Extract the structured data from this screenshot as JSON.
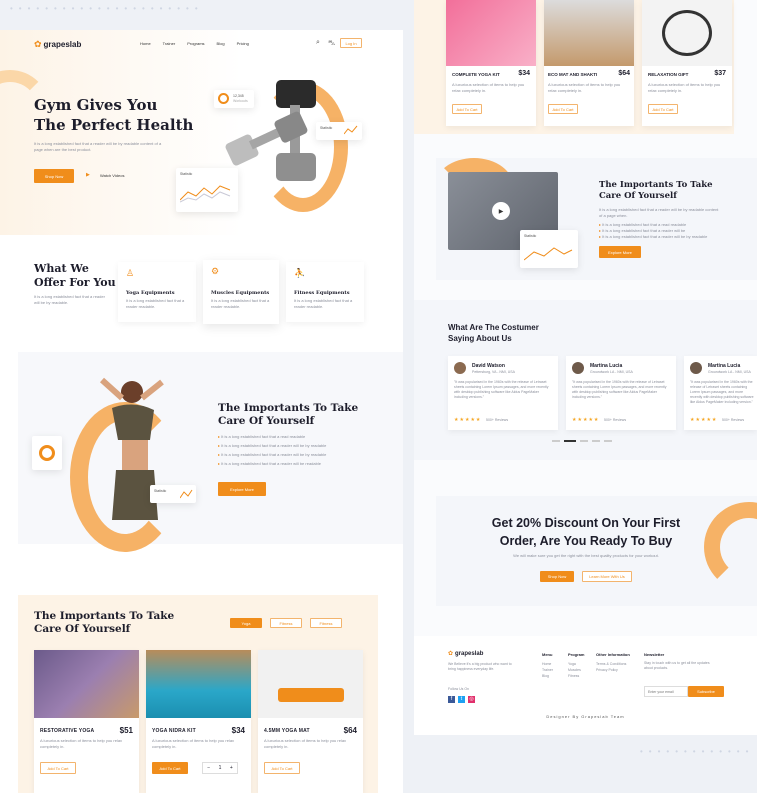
{
  "brand": "grapeslab",
  "nav": {
    "items": [
      "Home",
      "Trainer",
      "Programs",
      "Blog",
      "Pricing"
    ],
    "login": "Log In"
  },
  "hero": {
    "title_line1": "Gym Gives You",
    "title_line2": "The Perfect Health",
    "desc": "It is a long established fact that a reader will be by readable content of a page when are the best product.",
    "cta": "Shop Now",
    "watch": "Watch Videos",
    "stat_chip": "Statistic",
    "stat_value": "12,345",
    "stat_sub": "Workouts"
  },
  "offer": {
    "title_line1": "What We",
    "title_line2": "Offer For You",
    "desc": "It is a long established fact that a reader will be by readable.",
    "cards": [
      {
        "title": "Yoga Equipments",
        "desc": "It is a long established fact that a reader readable."
      },
      {
        "title": "Muscles Equipments",
        "desc": "It is a long established fact that a reader readable."
      },
      {
        "title": "Fitness Equipments",
        "desc": "It is a long established fact that a reader readable."
      }
    ]
  },
  "care": {
    "title_line1": "The Importants To Take",
    "title_line2": "Care Of Yourself",
    "bullets": [
      "It is a long established fact that a read readable",
      "It is a long established fact that a reader will be by readable",
      "It is a long established fact that a reader will be by readable",
      "It is a long established fact that a reader will be readable"
    ],
    "cta": "Explore More"
  },
  "products": {
    "title_line1": "The Importants To Take",
    "title_line2": "Care Of Yourself",
    "tabs": [
      "Yoga",
      "Fitness",
      "Fitness"
    ],
    "items": [
      {
        "name": "RESTORATIVE YOGA",
        "price": "$51",
        "desc": "A luxurious selection of items to help you relax completely in.",
        "btn": "Add To Cart"
      },
      {
        "name": "YOGA NIDRA KIT",
        "price": "$34",
        "desc": "A luxurious selection of items to help you relax completely in.",
        "btn": "Add To Cart",
        "qty": "1"
      },
      {
        "name": "4.5MM YOGA MAT",
        "price": "$64",
        "desc": "A luxurious selection of items to help you relax completely in.",
        "btn": "Add To Cart"
      }
    ]
  },
  "top_products": [
    {
      "name": "COMPLETE YOGA KIT",
      "price": "$34",
      "desc": "A luxurious selection of items to help you relax completely in.",
      "btn": "Add To Cart"
    },
    {
      "name": "ECO MAT AND SHAKTI",
      "price": "$64",
      "desc": "A luxurious selection of items to help you relax completely in.",
      "btn": "Add To Cart"
    },
    {
      "name": "RELAXATION GIFT",
      "price": "$37",
      "desc": "A luxurious selection of items to help you relax completely in.",
      "btn": "Add To Cart"
    }
  ],
  "care2": {
    "title_line1": "The Importants To Take",
    "title_line2": "Care Of Yourself",
    "desc": "It is a long established fact that a reader will be by readable content of a page when.",
    "bullets": [
      "It is a long established fact that a read readable",
      "It is a long established fact that a reader will be",
      "It is a long established fact that a reader will be by readable"
    ],
    "cta": "Explore More",
    "chip": "Statistic"
  },
  "testimonials": {
    "title_line1": "What Are The Costumer",
    "title_line2": "Saying About Us",
    "items": [
      {
        "name": "David Watson",
        "role": "Pettersburg, VA - NMI, USA",
        "text": "\"It was popularised in the 1960s with the release of Letraset sheets containing Lorem Ipsum passages, and more recently with desktop publishing software like Aldus PageMaker including versions.\"",
        "reviews": "500+ Reviews"
      },
      {
        "name": "Martina Lucia",
        "role": "Groundwork LA - NMI, USA",
        "text": "\"It was popularised in the 1960s with the release of Letraset sheets containing Lorem Ipsum passages, and more recently with desktop publishing software like Aldus PageMaker including versions.\"",
        "reviews": "500+ Reviews"
      },
      {
        "name": "Martina Lucia",
        "role": "Groundwork LA - NMI, USA",
        "text": "\"It was popularised in the 1960s with the release of Letraset sheets containing Lorem Ipsum passages, and more recently with desktop publishing software like Aldus PageMaker including version.\"",
        "reviews": "500+ Reviews"
      }
    ]
  },
  "discount": {
    "line1": "Get 20% Discount On Your First",
    "line2": "Order, Are You Ready To Buy",
    "desc": "We will make sure you get the right with the best quality products for your workout.",
    "shop": "Shop Now",
    "learn": "Learn More With Us"
  },
  "footer": {
    "about": "We Believe it's a big product who want to bring happiness everyday life.",
    "follow": "Follow Us On",
    "cols": [
      {
        "title": "Menu",
        "items": [
          "Home",
          "Trainer",
          "Blog"
        ]
      },
      {
        "title": "Program",
        "items": [
          "Yoga",
          "Muscles",
          "Fitness"
        ]
      },
      {
        "title": "Other Information",
        "items": [
          "Terms & Conditions",
          "Privacy Policy"
        ]
      }
    ],
    "newsletter": {
      "title": "Newsletter",
      "desc": "Stay in touch with us to get all the updates about products.",
      "placeholder": "Enter your email",
      "btn": "Subscribe"
    },
    "credit": "Designer By Grapeslab Team"
  },
  "colors": {
    "accent": "#f08d1b",
    "peach": "#fdf3e6"
  }
}
